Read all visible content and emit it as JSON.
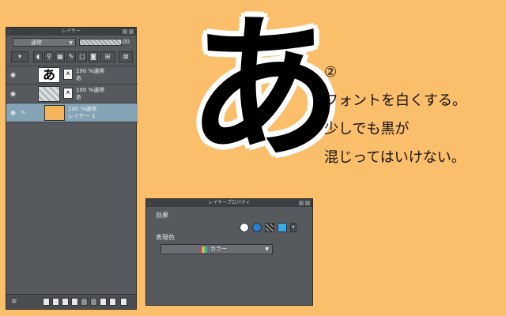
{
  "layer_panel": {
    "title": "レイヤー",
    "blend_mode": "通常",
    "opacity": "100",
    "layers": [
      {
        "thumb_char": "あ",
        "line1": "100 %通常",
        "line2": "あ"
      },
      {
        "line1": "100 %通常",
        "line2": "あ"
      },
      {
        "line1": "100 %通常",
        "line2": "レイヤー 1",
        "selected": true
      }
    ]
  },
  "big_character": "あ",
  "note": {
    "marker": "②",
    "lines": [
      "フォントを白くする。",
      "少しでも黒が",
      "混じってはいけない。"
    ]
  },
  "property_panel": {
    "title": "レイヤープロパティ",
    "effect_label": "効果",
    "expression_label": "表現色",
    "expression_value": "カラー"
  },
  "colors": {
    "background": "#fbbe6a",
    "panel": "#565a5e",
    "selected_layer": "#84a3b5",
    "fill_layer_thumb": "#f4b45b"
  }
}
